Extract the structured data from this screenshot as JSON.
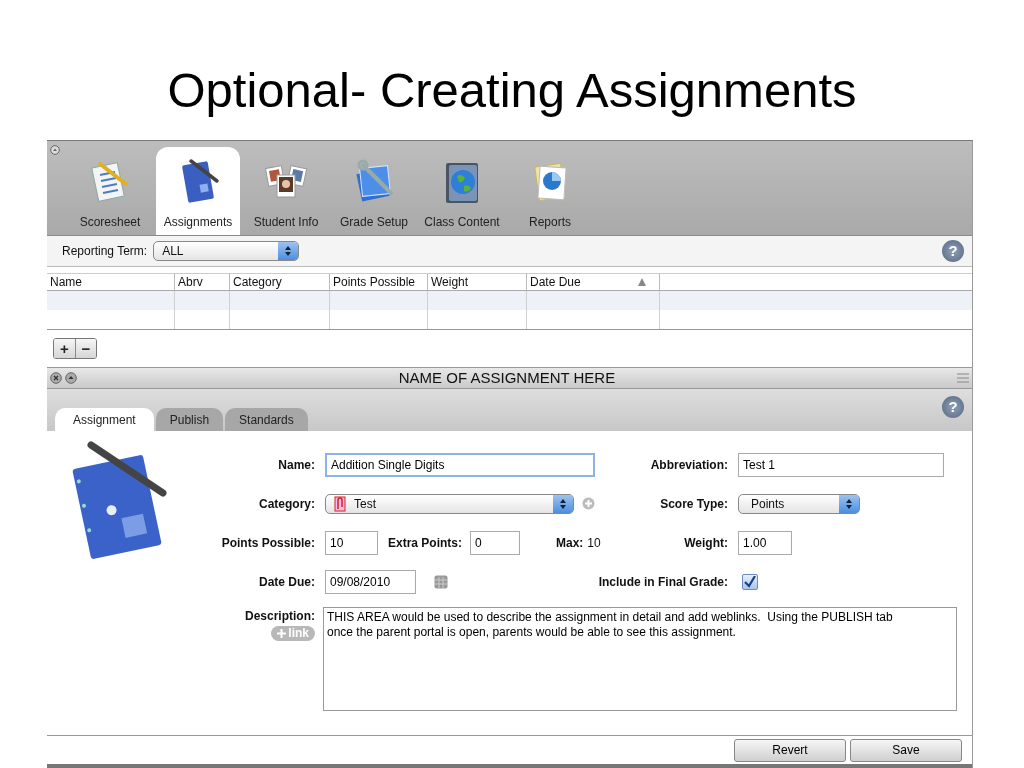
{
  "slide_title": "Optional- Creating Assignments",
  "toolbar": {
    "tabs": [
      {
        "label": "Scoresheet",
        "kind": "scoresheet",
        "selected": false
      },
      {
        "label": "Assignments",
        "kind": "notebook",
        "selected": true
      },
      {
        "label": "Student Info",
        "kind": "photos",
        "selected": false
      },
      {
        "label": "Grade Setup",
        "kind": "setup",
        "selected": false
      },
      {
        "label": "Class Content",
        "kind": "globe",
        "selected": false
      },
      {
        "label": "Reports",
        "kind": "report",
        "selected": false
      }
    ]
  },
  "reporting_term": {
    "label": "Reporting Term:",
    "value": "ALL"
  },
  "help_label": "?",
  "table": {
    "columns": [
      {
        "label": "Name",
        "sorted": false
      },
      {
        "label": "Abrv",
        "sorted": false
      },
      {
        "label": "Category",
        "sorted": false
      },
      {
        "label": "Points Possible",
        "sorted": false
      },
      {
        "label": "Weight",
        "sorted": false
      },
      {
        "label": "Date Due",
        "sorted": true
      }
    ]
  },
  "list_buttons": [
    "+",
    "−"
  ],
  "detail": {
    "title": "NAME OF ASSIGNMENT HERE",
    "tabs": [
      {
        "label": "Assignment",
        "selected": true
      },
      {
        "label": "Publish",
        "selected": false
      },
      {
        "label": "Standards",
        "selected": false
      }
    ],
    "name": {
      "label": "Name:",
      "value": "Addition Single Digits"
    },
    "abbreviation": {
      "label": "Abbreviation:",
      "value": "Test 1"
    },
    "category": {
      "label": "Category:",
      "value": "Test"
    },
    "score_type": {
      "label": "Score Type:",
      "value": "Points"
    },
    "points_possible": {
      "label": "Points Possible:",
      "value": "10"
    },
    "extra_points": {
      "label": "Extra Points:",
      "value": "0"
    },
    "max": {
      "label": "Max:",
      "value": "10"
    },
    "weight": {
      "label": "Weight:",
      "value": "1.00"
    },
    "date_due": {
      "label": "Date Due:",
      "value": "09/08/2010"
    },
    "include_in_final_grade": {
      "label": "Include in Final Grade:",
      "checked": true
    },
    "description": {
      "label": "Description:",
      "link_label": "link",
      "value": "THIS AREA would be used to describe the assignment in detail and add weblinks.  Using the PUBLISH tab\nonce the parent portal is open, parents would be able to see this assignment."
    },
    "buttons": [
      "Revert",
      "Save"
    ]
  }
}
